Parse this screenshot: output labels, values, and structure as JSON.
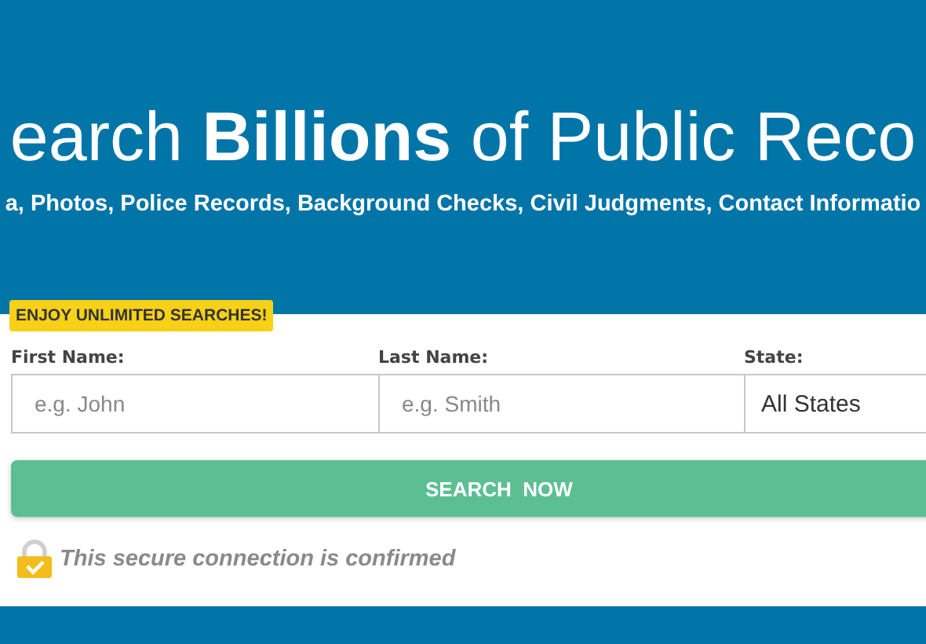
{
  "hero": {
    "headline": "earch **Billions** of Public Reco",
    "subtitle": "a, Photos, Police Records, Background Checks, Civil Judgments, Contact Informatio"
  },
  "form": {
    "badge": "ENJOY UNLIMITED SEARCHES!",
    "fields": [
      {
        "kind": "text",
        "label": "First Name:",
        "placeholder": "e.g. John"
      },
      {
        "kind": "text",
        "label": "Last Name:",
        "placeholder": "e.g. Smith"
      },
      {
        "kind": "select",
        "label": "State:",
        "value": "All States"
      }
    ],
    "submit": "SEARCH  NOW",
    "secure_note": "This secure connection is confirmed"
  }
}
